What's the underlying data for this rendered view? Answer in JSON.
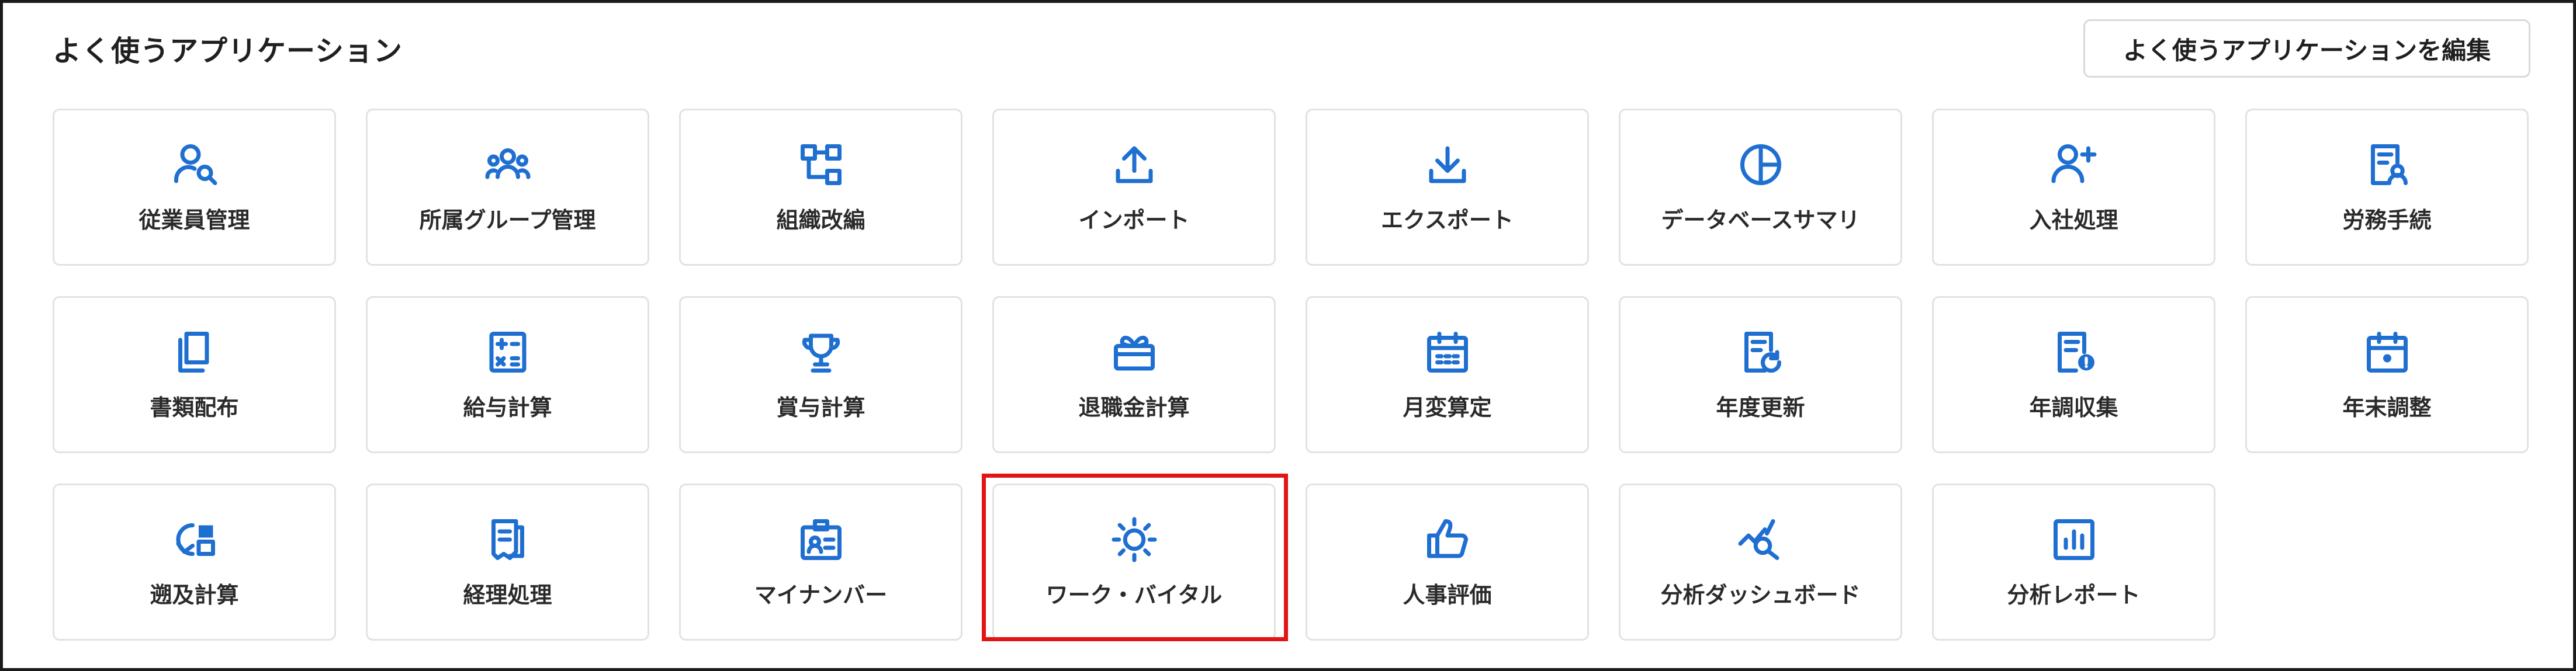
{
  "header": {
    "title": "よく使うアプリケーション",
    "edit_button": "よく使うアプリケーションを編集"
  },
  "accent_color": "#1f6fd1",
  "highlight_color": "#e31414",
  "apps": [
    {
      "label": "従業員管理",
      "icon": "user-search-icon"
    },
    {
      "label": "所属グループ管理",
      "icon": "group-icon"
    },
    {
      "label": "組織改編",
      "icon": "org-chart-icon"
    },
    {
      "label": "インポート",
      "icon": "upload-icon"
    },
    {
      "label": "エクスポート",
      "icon": "download-icon"
    },
    {
      "label": "データベースサマリ",
      "icon": "pie-chart-icon"
    },
    {
      "label": "入社処理",
      "icon": "user-add-icon"
    },
    {
      "label": "労務手続",
      "icon": "document-user-icon"
    },
    {
      "label": "書類配布",
      "icon": "documents-icon"
    },
    {
      "label": "給与計算",
      "icon": "calculator-icon"
    },
    {
      "label": "賞与計算",
      "icon": "trophy-icon"
    },
    {
      "label": "退職金計算",
      "icon": "gift-box-icon"
    },
    {
      "label": "月変算定",
      "icon": "calendar-grid-icon"
    },
    {
      "label": "年度更新",
      "icon": "document-refresh-icon"
    },
    {
      "label": "年調収集",
      "icon": "document-badge-icon"
    },
    {
      "label": "年末調整",
      "icon": "calendar-dot-icon"
    },
    {
      "label": "遡及計算",
      "icon": "retro-calc-icon"
    },
    {
      "label": "経理処理",
      "icon": "receipt-icon"
    },
    {
      "label": "マイナンバー",
      "icon": "id-card-icon"
    },
    {
      "label": "ワーク・バイタル",
      "icon": "sun-icon"
    },
    {
      "label": "人事評価",
      "icon": "thumbs-up-icon"
    },
    {
      "label": "分析ダッシュボード",
      "icon": "analytics-search-icon"
    },
    {
      "label": "分析レポート",
      "icon": "bar-chart-icon"
    }
  ]
}
